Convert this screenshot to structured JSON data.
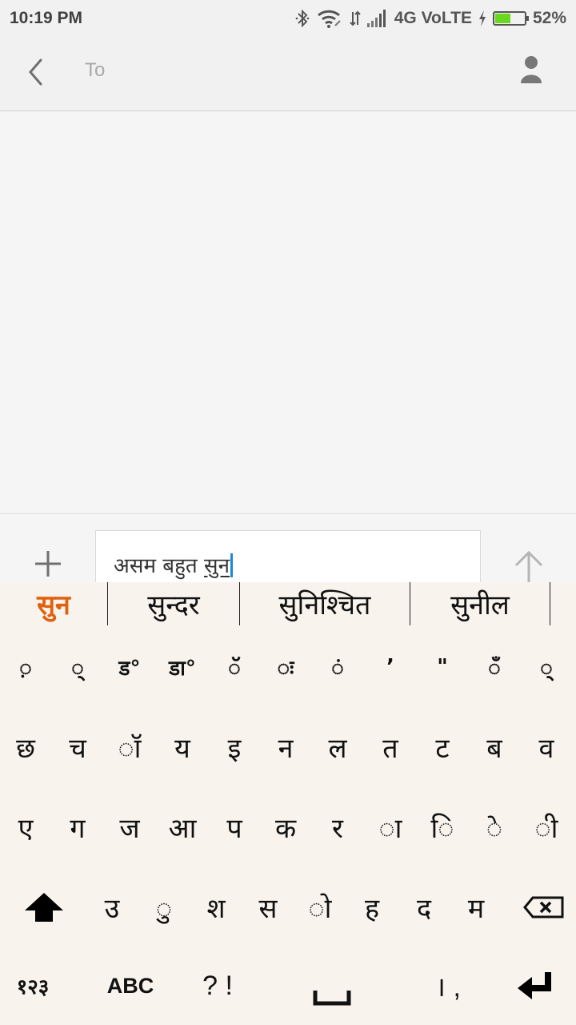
{
  "status_bar": {
    "time": "10:19 PM",
    "network_label": "4G VoLTE",
    "battery_percent_text": "52%",
    "battery_level": 0.52,
    "battery_color": "#6ad81e",
    "icons": [
      "bluetooth-icon",
      "wifi-icon",
      "data-transfer-icon",
      "signal-icon",
      "charging-icon",
      "battery-icon"
    ]
  },
  "header": {
    "recipient_placeholder": "To",
    "back_icon": "chevron-left-icon",
    "contact_icon": "person-icon"
  },
  "compose": {
    "message_committed": "असम बहुत ",
    "message_composing": "सुन",
    "attach_icon": "plus-icon",
    "send_icon": "arrow-up-icon"
  },
  "keyboard": {
    "accent_color": "#e0610f",
    "suggestions": [
      "सुन",
      "सुन्दर",
      "सुनिश्चित",
      "सुनील"
    ],
    "rows": [
      [
        "़",
        "्",
        "ड़",
        "ड़ा",
        "ॅ",
        "ः",
        "ं",
        "’",
        "\"",
        "ँ",
        "्"
      ],
      [
        "छ",
        "च",
        "ॉ",
        "य",
        "इ",
        "न",
        "ल",
        "त",
        "ट",
        "ब",
        "व"
      ],
      [
        "ए",
        "ग",
        "ज",
        "आ",
        "प",
        "क",
        "र",
        "ा",
        "ि",
        "े",
        "ी"
      ],
      [
        "उ",
        "ु",
        "श",
        "स",
        "ो",
        "ह",
        "द",
        "म"
      ]
    ],
    "row1_display": [
      "◌़",
      "◌्",
      "ड°",
      "डा°",
      "◌ॅ",
      "◌ः",
      "◌ं",
      "’",
      "\"",
      "◌ँ",
      "◌्"
    ],
    "row2_display": [
      "छ",
      "च",
      "◌ॉ",
      "य",
      "इ",
      "न",
      "ल",
      "त",
      "ट",
      "ब",
      "व"
    ],
    "row3_display": [
      "ए",
      "ग",
      "ज",
      "आ",
      "प",
      "क",
      "र",
      "◌ा",
      "◌ि",
      "◌े",
      "◌ी"
    ],
    "row4_display": [
      "उ",
      "◌ु",
      "श",
      "स",
      "◌ो",
      "ह",
      "द",
      "म"
    ],
    "bottom": {
      "numbers_label": "१२३",
      "abc_label": "ABC",
      "punct_label": "? !",
      "danda_label": "। ,"
    }
  }
}
